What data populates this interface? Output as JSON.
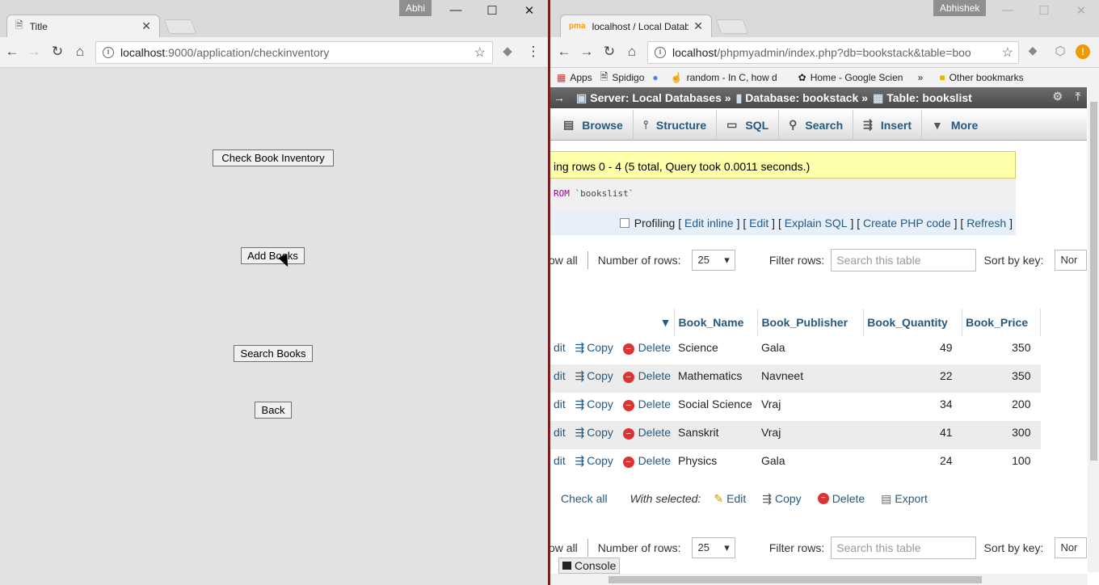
{
  "left": {
    "profile": "Abhi",
    "tab_title": "Title",
    "url_host": "localhost",
    "url_rest": ":9000/application/checkinventory",
    "buttons": {
      "check_inventory": "Check Book Inventory",
      "add_books": "Add Books",
      "search_books": "Search Books",
      "back": "Back"
    }
  },
  "right": {
    "profile": "Abhishek",
    "tab_title": "localhost / Local Databas",
    "url_host": "localhost",
    "url_rest": "/phpmyadmin/index.php?db=bookstack&table=boo",
    "bookmarks": [
      "Apps",
      "Spidigo",
      "random - In C, how d",
      "Home - Google Scien",
      "Other bookmarks"
    ],
    "breadcrumb": {
      "server": "Server: Local Databases »",
      "database": "Database: bookstack »",
      "table": "Table: bookslist"
    },
    "menu": [
      "Browse",
      "Structure",
      "SQL",
      "Search",
      "Insert",
      "More"
    ],
    "success_msg": "ing rows 0 - 4 (5 total, Query took 0.0011 seconds.)",
    "sql_kw": "ROM",
    "sql_rest": " `bookslist`",
    "links": {
      "profiling": "Profiling",
      "edit_inline": "Edit inline",
      "edit": "Edit",
      "explain": "Explain SQL",
      "php": "Create PHP code",
      "refresh": "Refresh"
    },
    "nav": {
      "show_all": "ow all",
      "rows_label": "Number of rows:",
      "rows_value": "25",
      "filter_label": "Filter rows:",
      "search_placeholder": "Search this table",
      "sort_label": "Sort by key:",
      "sort_value": "Nor"
    },
    "columns": [
      "Book_Name",
      "Book_Publisher",
      "Book_Quantity",
      "Book_Price"
    ],
    "actions": {
      "edit": "dit",
      "copy": "Copy",
      "delete": "Delete"
    },
    "rows": [
      {
        "name": "Science",
        "publisher": "Gala",
        "quantity": "49",
        "price": "350"
      },
      {
        "name": "Mathematics",
        "publisher": "Navneet",
        "quantity": "22",
        "price": "350"
      },
      {
        "name": "Social Science",
        "publisher": "Vraj",
        "quantity": "34",
        "price": "200"
      },
      {
        "name": "Sanskrit",
        "publisher": "Vraj",
        "quantity": "41",
        "price": "300"
      },
      {
        "name": "Physics",
        "publisher": "Gala",
        "quantity": "24",
        "price": "100"
      }
    ],
    "bulk": {
      "check_all": "Check all",
      "with_selected": "With selected:",
      "edit": "Edit",
      "copy": "Copy",
      "delete": "Delete",
      "export": "Export"
    },
    "console": "Console"
  }
}
